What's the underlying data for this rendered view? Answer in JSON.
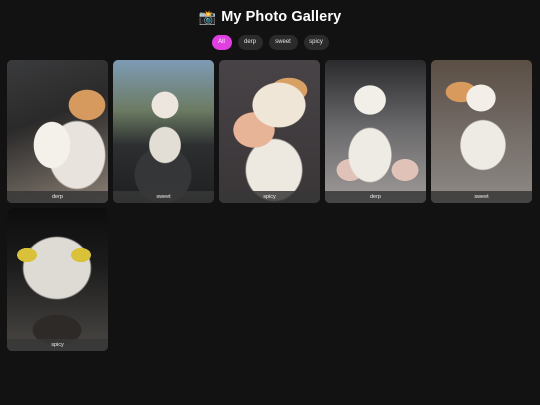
{
  "header": {
    "icon": "camera-icon",
    "icon_glyph": "📸",
    "title": "My Photo Gallery"
  },
  "filters": [
    {
      "label": "All",
      "active": true
    },
    {
      "label": "derp",
      "active": false
    },
    {
      "label": "sweet",
      "active": false
    },
    {
      "label": "spicy",
      "active": false
    }
  ],
  "colors": {
    "background": "#121212",
    "accent": "#e040e0",
    "chip": "#2b2b2b"
  },
  "photos": [
    {
      "tag": "derp"
    },
    {
      "tag": "sweet"
    },
    {
      "tag": "spicy"
    },
    {
      "tag": "derp"
    },
    {
      "tag": "sweet"
    },
    {
      "tag": "spicy"
    }
  ]
}
